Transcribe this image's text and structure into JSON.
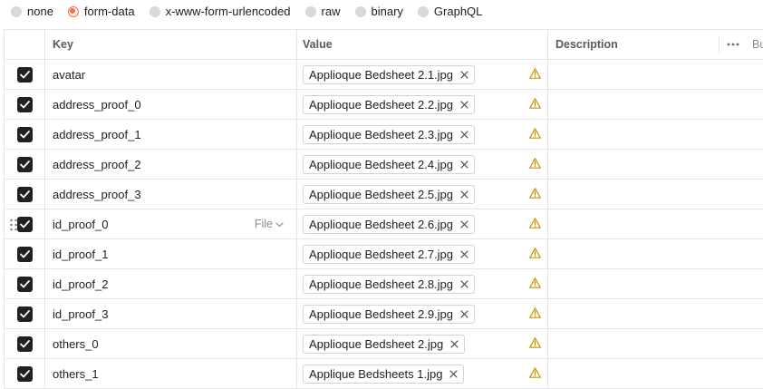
{
  "body_types": [
    {
      "label": "none",
      "selected": false
    },
    {
      "label": "form-data",
      "selected": true
    },
    {
      "label": "x-www-form-urlencoded",
      "selected": false
    },
    {
      "label": "raw",
      "selected": false
    },
    {
      "label": "binary",
      "selected": false
    },
    {
      "label": "GraphQL",
      "selected": false
    }
  ],
  "table": {
    "headers": {
      "key": "Key",
      "value": "Value",
      "description": "Description",
      "bulk_edit": "Bu"
    },
    "file_type_label": "File",
    "rows": [
      {
        "key": "avatar",
        "value": "Applioque Bedsheet 2.1.jpg",
        "checked": true
      },
      {
        "key": "address_proof_0",
        "value": "Applioque Bedsheet 2.2.jpg",
        "checked": true
      },
      {
        "key": "address_proof_1",
        "value": "Applioque Bedsheet 2.3.jpg",
        "checked": true
      },
      {
        "key": "address_proof_2",
        "value": "Applioque Bedsheet 2.4.jpg",
        "checked": true
      },
      {
        "key": "address_proof_3",
        "value": "Applioque Bedsheet 2.5.jpg",
        "checked": true
      },
      {
        "key": "id_proof_0",
        "value": "Applioque Bedsheet 2.6.jpg",
        "checked": true,
        "hovered": true
      },
      {
        "key": "id_proof_1",
        "value": "Applioque Bedsheet 2.7.jpg",
        "checked": true
      },
      {
        "key": "id_proof_2",
        "value": "Applioque Bedsheet 2.8.jpg",
        "checked": true
      },
      {
        "key": "id_proof_3",
        "value": "Applioque Bedsheet 2.9.jpg",
        "checked": true
      },
      {
        "key": "others_0",
        "value": "Applioque Bedsheet 2.jpg",
        "checked": true
      },
      {
        "key": "others_1",
        "value": "Applique Bedsheets 1.jpg",
        "checked": true
      }
    ]
  },
  "colors": {
    "accent": "#ff6c37",
    "warning": "#c79400",
    "checkbox": "#212121",
    "border": "#e6e6e6"
  }
}
